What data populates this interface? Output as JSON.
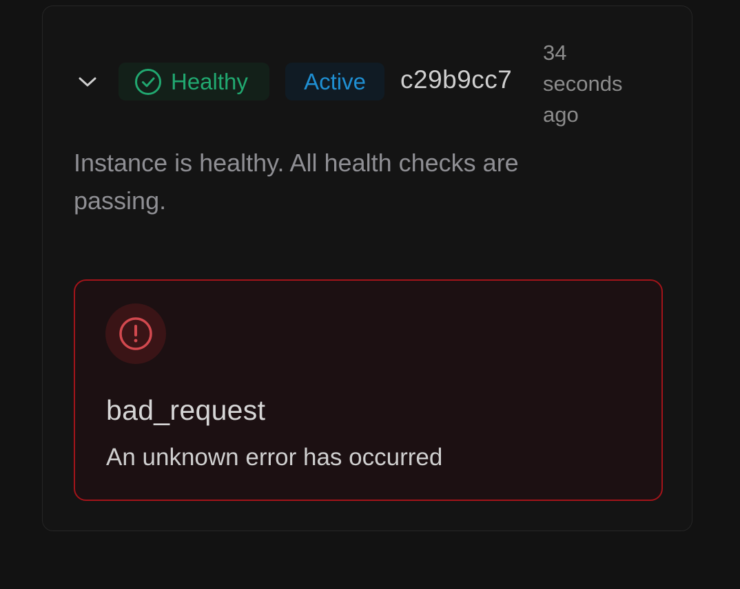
{
  "instance": {
    "health_label": "Healthy",
    "state_label": "Active",
    "commit": "c29b9cc7",
    "time_ago": "34 seconds ago",
    "description": "Instance is healthy. All health checks are passing.",
    "icons": {
      "expand": "chevron-down-icon",
      "health": "check-circle-icon"
    }
  },
  "error": {
    "icon": "exclamation-circle-icon",
    "title": "bad_request",
    "message": "An unknown error has occurred"
  },
  "colors": {
    "healthy": "#21a870",
    "active": "#1f8fd2",
    "error_border": "#a3141a",
    "error_icon": "#d2494f"
  }
}
